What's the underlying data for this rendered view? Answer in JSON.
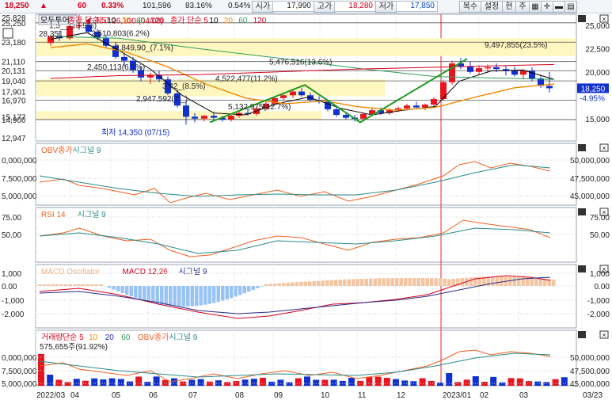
{
  "toolbar": {
    "price": "18,250",
    "change_arrow": "▲",
    "change": "60",
    "change_pct": "0.33%",
    "volume": "101,596",
    "volume_ratio": "83.16%",
    "turnover": "0.54%",
    "open_label": "시가",
    "open": "17,990",
    "high_label": "고가",
    "high": "18,280",
    "low_label": "저가",
    "low": "17,850",
    "btn_copy": "복수",
    "btn_settings": "설정",
    "btn_current": "현",
    "btn_week": "주"
  },
  "panels": {
    "price": {
      "legend": [
        {
          "text": "모두투어",
          "color": "#000000"
        },
        {
          "text": "종가 단순 5",
          "color": "#d6001c"
        },
        {
          "text": "10",
          "color": "#000000"
        },
        {
          "text": "20",
          "color": "#f08a00"
        },
        {
          "text": "60",
          "color": "#2e9e5b"
        },
        {
          "text": "120",
          "color": "#d6001c"
        },
        {
          "text": "종가 단순 5",
          "color": "#d6001c"
        },
        {
          "text": "10",
          "color": "#000000"
        },
        {
          "text": "20",
          "color": "#f08a00"
        },
        {
          "text": "60",
          "color": "#2e9e5b"
        },
        {
          "text": "120",
          "color": "#d6001c"
        }
      ],
      "left_ticks": [
        "25,828",
        "25,250",
        "23,180",
        "21,110",
        "20,131",
        "19,040",
        "17,901",
        "16,970",
        "15,177",
        "14,900",
        "12,947"
      ],
      "right_ticks": [
        "25,000",
        "22,500",
        "20,000",
        "15,000"
      ],
      "right_pct": "-4.95%",
      "current_price_tag": "18,250",
      "annotations": {
        "high": "최고 26,100 (04/08)",
        "low": "최저 14,350 (07/15)",
        "a1": "1,5__(13.9%)",
        "a2": "2,510,803(6.2%)",
        "a3": "2,849,90_(7.1%)",
        "a4": "2,450,113(6.1%)",
        "a5": "3,42_(8.5%)",
        "a6": "2,947,592(7._)",
        "a7": "4,522,477(11.2%)",
        "a8": "5,476,516(13.6%)",
        "a9": "5,132,975(12.7%)",
        "a10": "9,497,855(23.5%)",
        "a11": "28,351"
      }
    },
    "obv": {
      "legend": [
        {
          "text": "OBV종가",
          "color": "#f06020"
        },
        {
          "text": "시그널 9",
          "color": "#2a8a8a"
        }
      ],
      "left_ticks": [
        "0,000,000",
        "7,500,000",
        "5,000,000"
      ],
      "right_ticks": [
        "50,000,000",
        "47,500,000",
        "45,000,000"
      ]
    },
    "rsi": {
      "legend": [
        {
          "text": "RSI 14",
          "color": "#f06020"
        },
        {
          "text": "시그널 9",
          "color": "#2a8a8a"
        }
      ],
      "left_ticks": [
        "75.00",
        "50.00"
      ],
      "right_ticks": [
        "75.00",
        "50.00"
      ]
    },
    "macd": {
      "legend": [
        {
          "text": "MACD Oscillator",
          "color": "#f0b080"
        },
        {
          "text": "MACD 12,26",
          "color": "#d6001c"
        },
        {
          "text": "시그널 9",
          "color": "#2a2a8a"
        }
      ],
      "left_ticks": [
        "1,000",
        "0.00",
        "-1,000",
        "-2,000"
      ],
      "right_ticks": [
        "1,000",
        "0.00",
        "-1,000",
        "-2,000"
      ]
    },
    "volume": {
      "legend": [
        {
          "text": "거래량",
          "color": "#d6001c"
        },
        {
          "text": "단순 5",
          "color": "#d6001c"
        },
        {
          "text": "10",
          "color": "#f08a00"
        },
        {
          "text": "20",
          "color": "#2a2ad0"
        },
        {
          "text": "60",
          "color": "#2e9e5b"
        },
        {
          "text": "OBV종가",
          "color": "#f06020"
        },
        {
          "text": "시그널 9",
          "color": "#2a8a8a"
        }
      ],
      "annotation": "575,655주(91.92%)",
      "left_ticks": [
        "0,000,000",
        "7,500,000",
        "5,000,000"
      ],
      "right_ticks": [
        "50,000,000",
        "47,500,000",
        "45,000,000"
      ]
    }
  },
  "xaxis": {
    "labels": [
      "2022/03",
      "04",
      "05",
      "06",
      "07",
      "08",
      "09",
      "10",
      "11",
      "12",
      "2023/01",
      "02",
      "03"
    ],
    "right_label": "03/23"
  },
  "colors": {
    "up": "#e8141e",
    "down": "#1030d0",
    "bg": "#ffffff",
    "grid": "#c8c8c8"
  }
}
